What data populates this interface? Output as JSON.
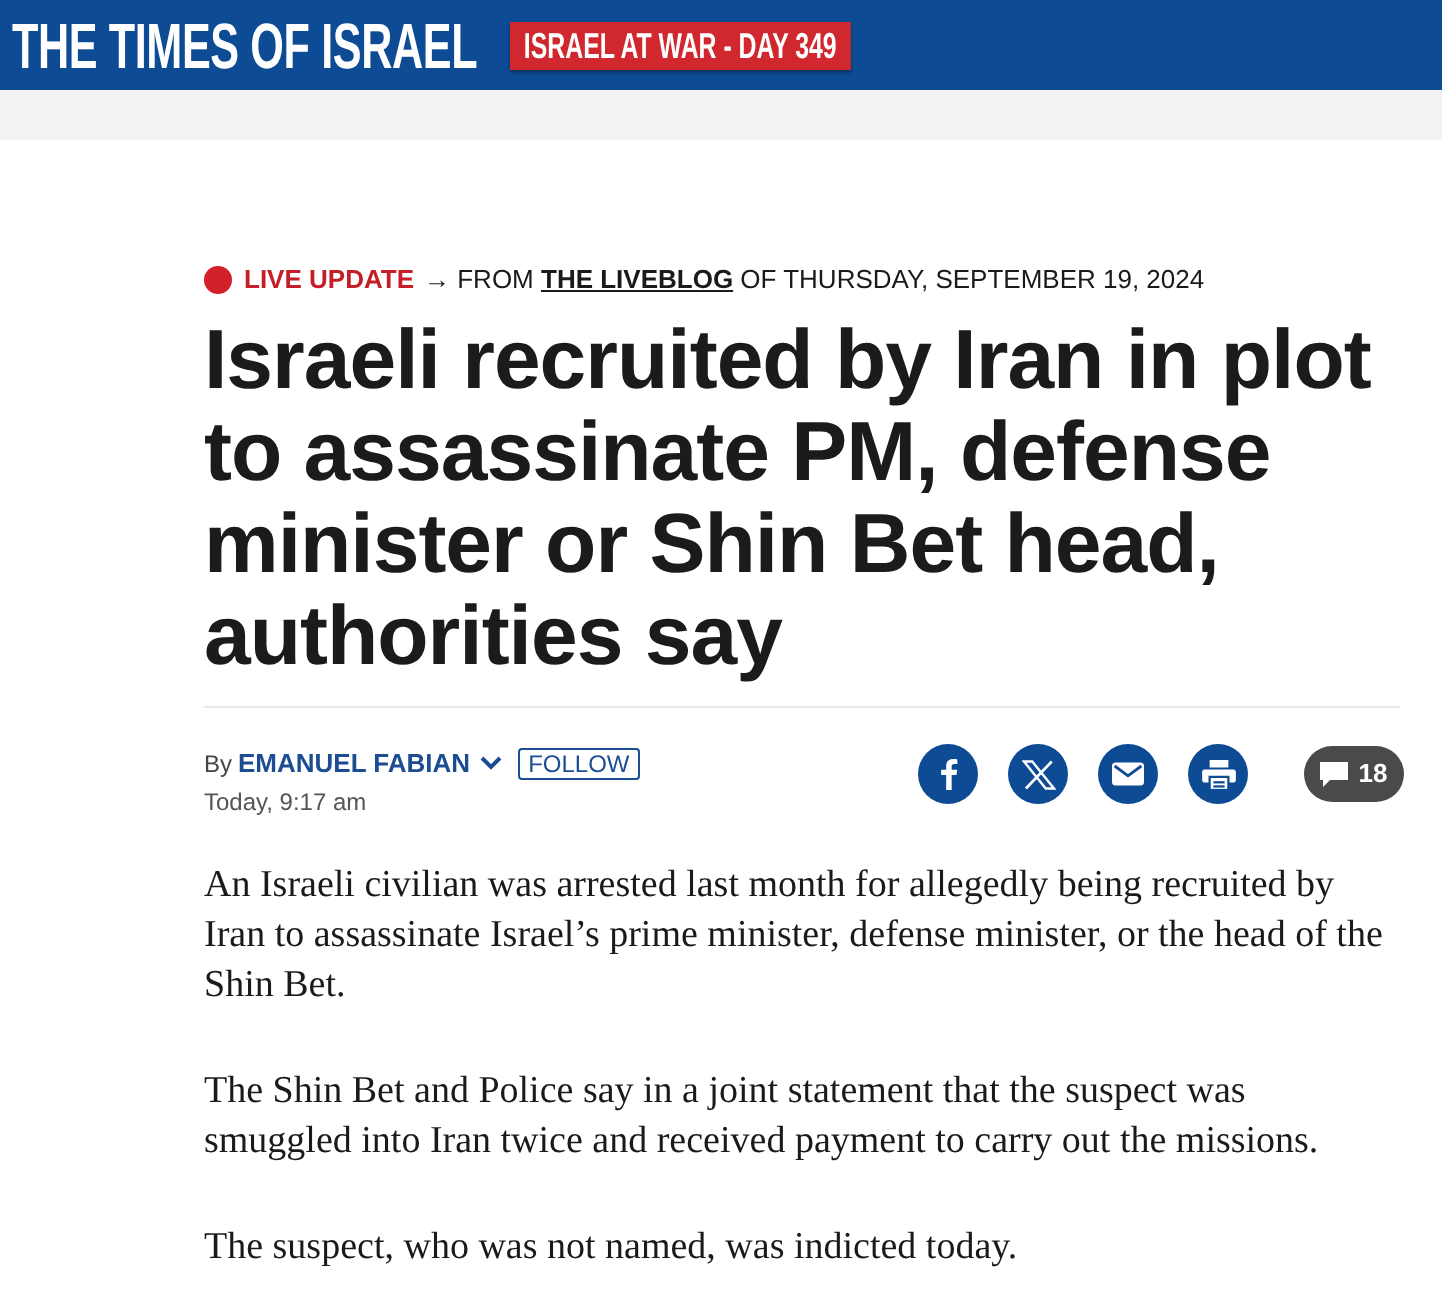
{
  "header": {
    "logo": "THE TIMES OF ISRAEL",
    "badge": "ISRAEL AT WAR - DAY 349"
  },
  "article": {
    "kicker": {
      "label": "LIVE UPDATE",
      "arrow": "→",
      "source_prefix": "FROM",
      "source_link": "THE LIVEBLOG",
      "source_suffix": "OF THURSDAY, SEPTEMBER 19, 2024"
    },
    "headline": "Israeli recruited by Iran in plot to assassinate PM, defense minister or Shin Bet head, authorities say",
    "byline": {
      "prefix": "By",
      "author": "EMANUEL FABIAN",
      "follow": "FOLLOW",
      "time": "Today, 9:17 am"
    },
    "share": [
      {
        "kind": "f"
      },
      {
        "kind": "x"
      },
      {
        "kind": "mail"
      },
      {
        "kind": "print"
      }
    ],
    "comments": {
      "count": "18"
    },
    "paragraphs": [
      "An Israeli civilian was arrested last month for allegedly being recruited by Iran to assassinate Israel’s prime minister, defense minister, or the head of the Shin Bet.",
      "The Shin Bet and Police say in a joint statement that the suspect was smuggled into Iran twice and received payment to carry out the missions.",
      "The suspect, who was not named, was indicted today."
    ]
  }
}
